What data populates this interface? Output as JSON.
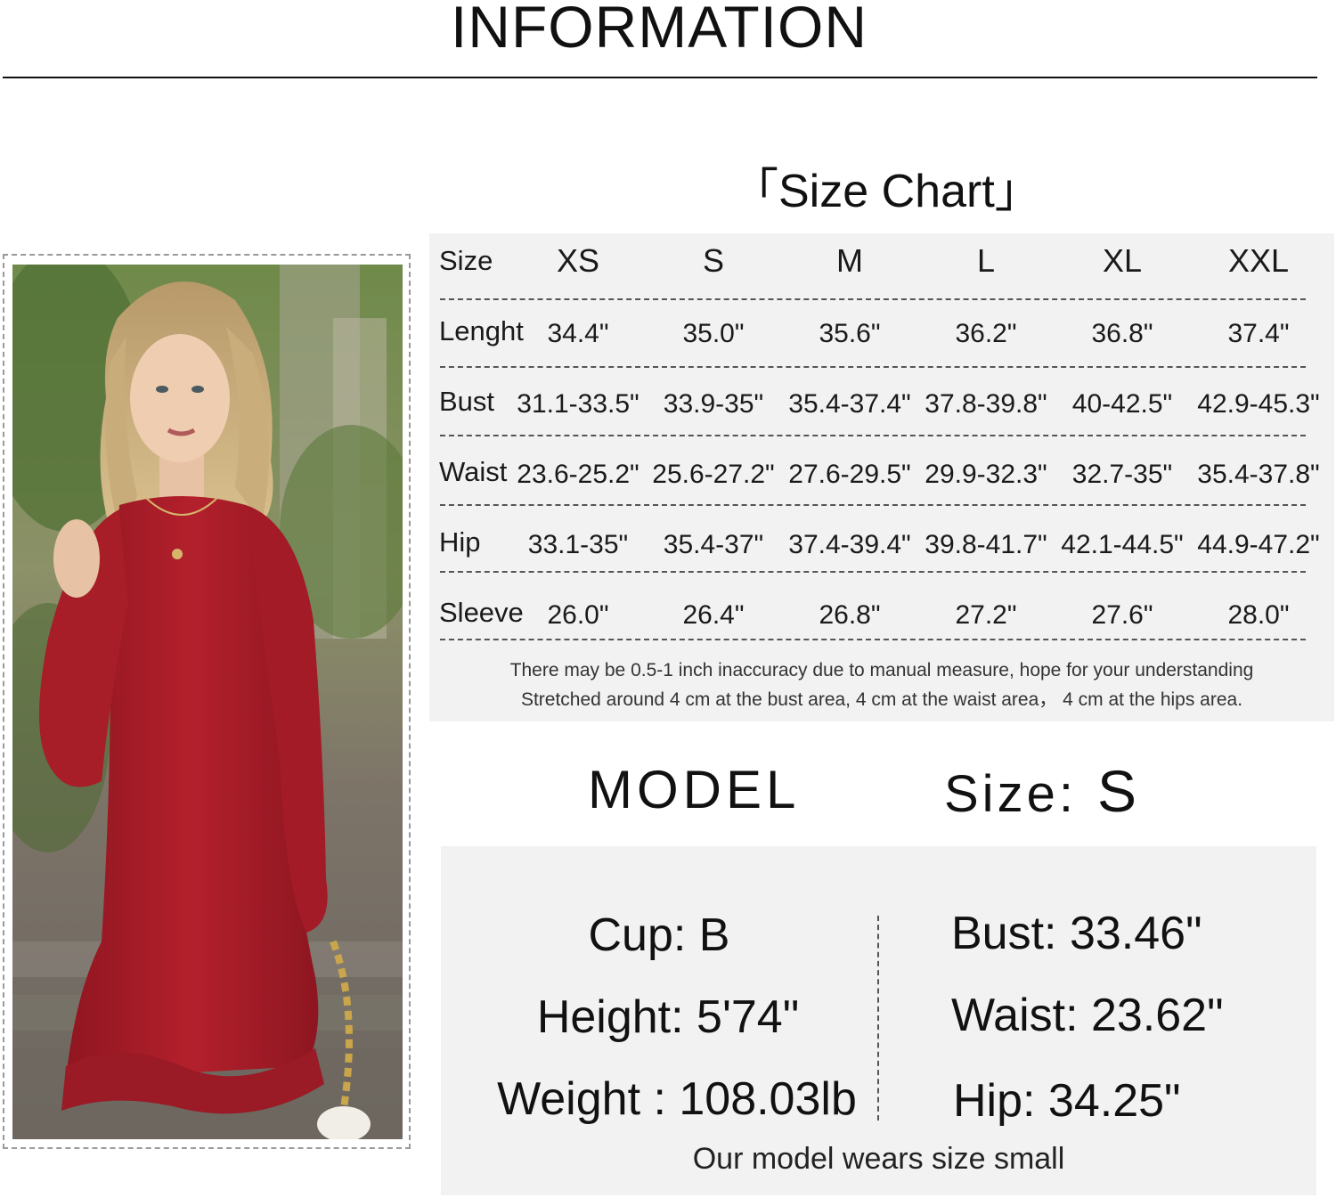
{
  "header": {
    "title": "INFORMATION"
  },
  "size_chart": {
    "title": "「Size Chart」",
    "header": {
      "label": "Size",
      "sizes": [
        "XS",
        "S",
        "M",
        "L",
        "XL",
        "XXL"
      ]
    },
    "rows": [
      {
        "label": "Lenght",
        "values": [
          "34.4\"",
          "35.0\"",
          "35.6\"",
          "36.2\"",
          "36.8\"",
          "37.4\""
        ]
      },
      {
        "label": "Bust",
        "values": [
          "31.1-33.5\"",
          "33.9-35\"",
          "35.4-37.4\"",
          "37.8-39.8\"",
          "40-42.5\"",
          "42.9-45.3\""
        ]
      },
      {
        "label": "Waist",
        "values": [
          "23.6-25.2\"",
          "25.6-27.2\"",
          "27.6-29.5\"",
          "29.9-32.3\"",
          "32.7-35\"",
          "35.4-37.8\""
        ]
      },
      {
        "label": "Hip",
        "values": [
          "33.1-35\"",
          "35.4-37\"",
          "37.4-39.4\"",
          "39.8-41.7\"",
          "42.1-44.5\"",
          "44.9-47.2\""
        ]
      },
      {
        "label": "Sleeve",
        "values": [
          "26.0\"",
          "26.4\"",
          "26.8\"",
          "27.2\"",
          "27.6\"",
          "28.0\""
        ]
      }
    ],
    "notes": [
      "There may be 0.5-1 inch inaccuracy due to manual measure, hope for your understanding",
      "Stretched around 4 cm at the bust area, 4 cm at the waist area， 4 cm at the hips area."
    ]
  },
  "model": {
    "title": "MODEL",
    "size_label": "Size:",
    "size_value": "S",
    "left_stats": [
      "Cup: B",
      "Height: 5'74\"",
      "Weight : 108.03lb"
    ],
    "right_stats": [
      "Bust: 33.46\"",
      "Waist: 23.62\"",
      "Hip: 34.25\""
    ],
    "note": "Our model wears size small"
  },
  "colors": {
    "dress": "#b01e2a",
    "panel": "#f2f2f2",
    "text": "#111111"
  }
}
